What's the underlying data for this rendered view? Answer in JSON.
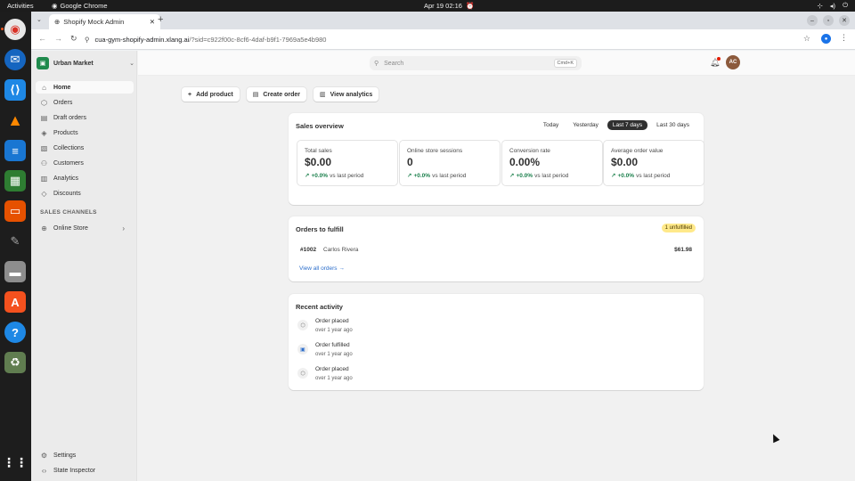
{
  "system": {
    "activities": "Activities",
    "app_name": "Google Chrome",
    "clock": "Apr 19  02:16"
  },
  "browser": {
    "tab_title": "Shopify Mock Admin",
    "url_host": "cua-gym-shopify-admin.xlang.ai",
    "url_rest": "/?sid=c922f00c-8cf6-4daf-b9f1-7969a5e4b980"
  },
  "sidebar": {
    "store_name": "Urban Market",
    "items": [
      {
        "label": "Home",
        "icon": "home-icon"
      },
      {
        "label": "Orders",
        "icon": "orders-icon"
      },
      {
        "label": "Draft orders",
        "icon": "draft-orders-icon"
      },
      {
        "label": "Products",
        "icon": "products-icon"
      },
      {
        "label": "Collections",
        "icon": "collections-icon"
      },
      {
        "label": "Customers",
        "icon": "customers-icon"
      },
      {
        "label": "Analytics",
        "icon": "analytics-icon"
      },
      {
        "label": "Discounts",
        "icon": "discounts-icon"
      }
    ],
    "section_label": "SALES CHANNELS",
    "channel": "Online Store",
    "settings": "Settings",
    "state_inspector": "State Inspector"
  },
  "header": {
    "search_placeholder": "Search",
    "search_shortcut": "Cmd+K",
    "avatar_initials": "AC"
  },
  "actions": {
    "add_product": "Add product",
    "create_order": "Create order",
    "view_analytics": "View analytics"
  },
  "sales_overview": {
    "title": "Sales overview",
    "ranges": [
      "Today",
      "Yesterday",
      "Last 7 days",
      "Last 30 days"
    ],
    "selected_range": "Last 7 days",
    "metrics": [
      {
        "label": "Total sales",
        "value": "$0.00",
        "change": "+0.0%",
        "suffix": "vs last period"
      },
      {
        "label": "Online store sessions",
        "value": "0",
        "change": "+0.0%",
        "suffix": "vs last period"
      },
      {
        "label": "Conversion rate",
        "value": "0.00%",
        "change": "+0.0%",
        "suffix": "vs last period"
      },
      {
        "label": "Average order value",
        "value": "$0.00",
        "change": "+0.0%",
        "suffix": "vs last period"
      }
    ]
  },
  "orders_to_fulfill": {
    "title": "Orders to fulfill",
    "badge": "1 unfulfilled",
    "order_id": "#1002",
    "customer": "Carlos Rivera",
    "amount": "$61.98",
    "view_all": "View all orders"
  },
  "recent_activity": {
    "title": "Recent activity",
    "items": [
      {
        "title": "Order placed",
        "time": "over 1 year ago"
      },
      {
        "title": "Order fulfilled",
        "time": "over 1 year ago"
      },
      {
        "title": "Order placed",
        "time": "over 1 year ago"
      }
    ]
  }
}
